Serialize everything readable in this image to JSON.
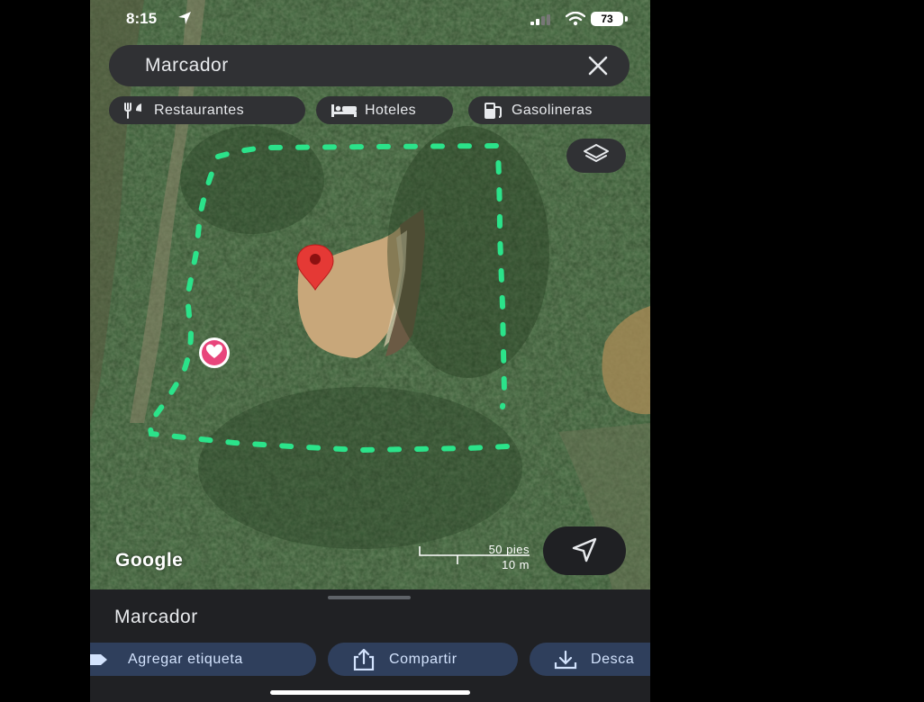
{
  "status_bar": {
    "time": "8:15",
    "battery": "73"
  },
  "search": {
    "query": "Marcador"
  },
  "chips": [
    {
      "label": "Restaurantes",
      "icon": "fork-knife-icon"
    },
    {
      "label": "Hoteles",
      "icon": "bed-icon"
    },
    {
      "label": "Gasolineras",
      "icon": "gas-station-icon"
    }
  ],
  "map": {
    "attribution": "Google",
    "scale": {
      "feet": "50 pies",
      "meters": "10 m"
    },
    "boundary_color": "#2be38a",
    "pin_color": "#e53935"
  },
  "sheet": {
    "title": "Marcador",
    "actions": [
      {
        "label": "Agregar etiqueta",
        "icon": "label-icon"
      },
      {
        "label": "Compartir",
        "icon": "share-icon"
      },
      {
        "label": "Desca",
        "icon": "download-icon"
      }
    ]
  }
}
